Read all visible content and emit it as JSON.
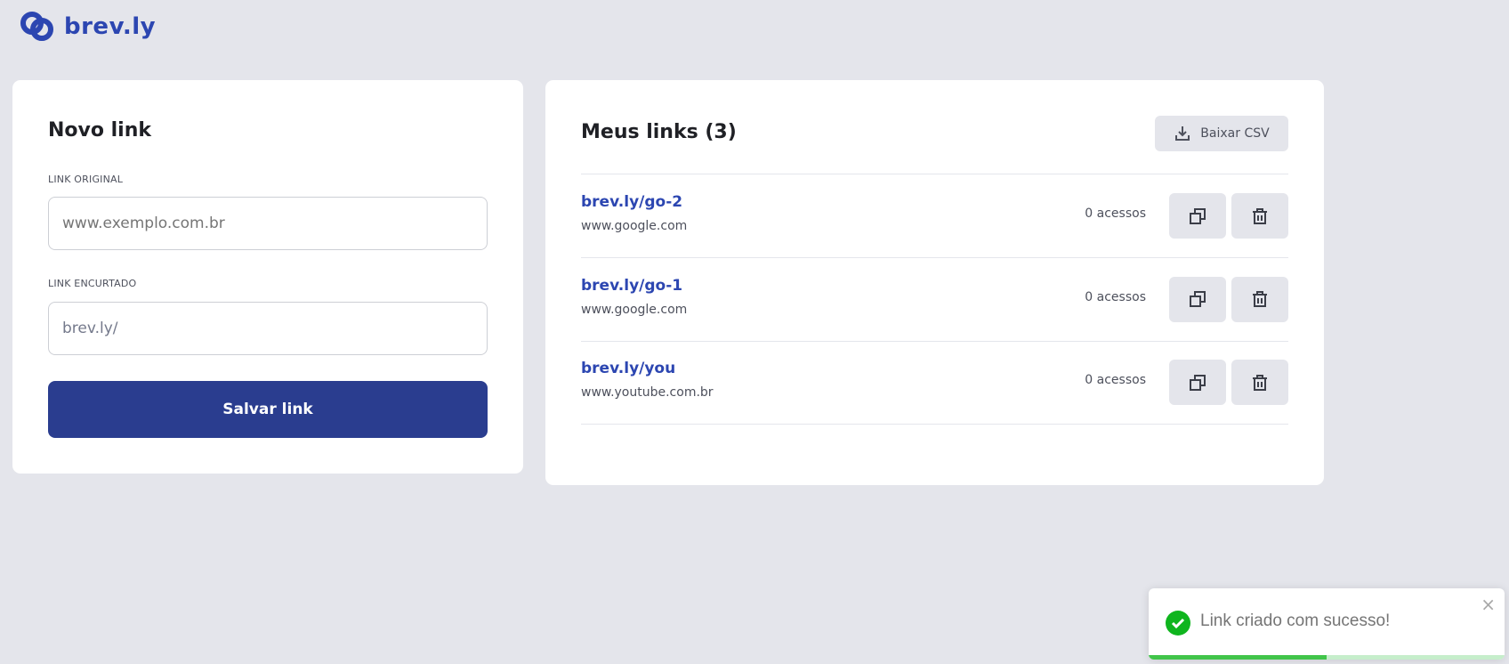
{
  "brand": {
    "name": "brev.ly",
    "color": "#2c46b1"
  },
  "new_link": {
    "title": "Novo link",
    "original_label": "LINK ORIGINAL",
    "original_placeholder": "www.exemplo.com.br",
    "short_label": "LINK ENCURTADO",
    "short_prefix": "brev.ly/",
    "save_label": "Salvar link"
  },
  "my_links": {
    "title": "Meus links (3)",
    "csv_label": "Baixar CSV",
    "items": [
      {
        "short": "brev.ly/go-2",
        "original": "www.google.com",
        "accesses": "0 acessos"
      },
      {
        "short": "brev.ly/go-1",
        "original": "www.google.com",
        "accesses": "0 acessos"
      },
      {
        "short": "brev.ly/you",
        "original": "www.youtube.com.br",
        "accesses": "0 acessos"
      }
    ]
  },
  "toast": {
    "message": "Link criado com sucesso!",
    "close": "×",
    "progress": 0.5
  }
}
